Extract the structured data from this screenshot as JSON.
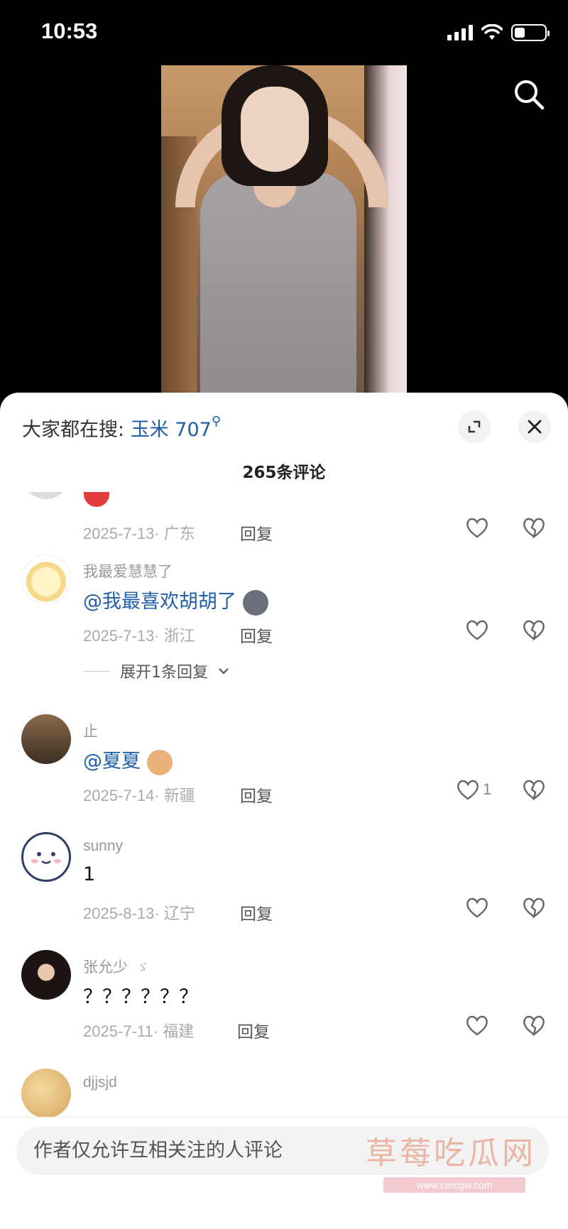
{
  "status_bar": {
    "time": "10:53",
    "battery_level": 0.35
  },
  "video": {
    "search_icon": "search-icon"
  },
  "sheet": {
    "trending_prefix": "大家都在搜: ",
    "trending_term": "玉米 707",
    "comment_count": "265条评论",
    "expand_icon": "expand-icon",
    "close_icon": "close-icon"
  },
  "comments": [
    {
      "username": "",
      "text": "",
      "meta": "2025-7-13· 广东",
      "reply": "回复",
      "likes": ""
    },
    {
      "username": "我最爱慧慧了",
      "mention": "@我最喜欢胡胡了",
      "text": "",
      "meta": "2025-7-13· 浙江",
      "reply": "回复",
      "likes": "",
      "expand_label": "展开1条回复"
    },
    {
      "username": "止",
      "mention": "@夏夏",
      "text": "",
      "meta": "2025-7-14· 新疆",
      "reply": "回复",
      "likes": "1"
    },
    {
      "username": "sunny",
      "text": "1",
      "meta": "2025-8-13· 辽宁",
      "reply": "回复",
      "likes": ""
    },
    {
      "username": "张允少",
      "text": "？？？？？？",
      "meta": "2025-7-11· 福建",
      "reply": "回复",
      "likes": ""
    },
    {
      "username": "djjsjd",
      "text": ""
    }
  ],
  "bottom": {
    "input_placeholder": "作者仅允许互相关注的人评论",
    "watermark": "草莓吃瓜网",
    "watermark_url": "www.cmcgw.com"
  },
  "colors": {
    "accent": "#1f5ea8",
    "meta": "#aaaaaa",
    "sheet_bg": "#ffffff"
  }
}
